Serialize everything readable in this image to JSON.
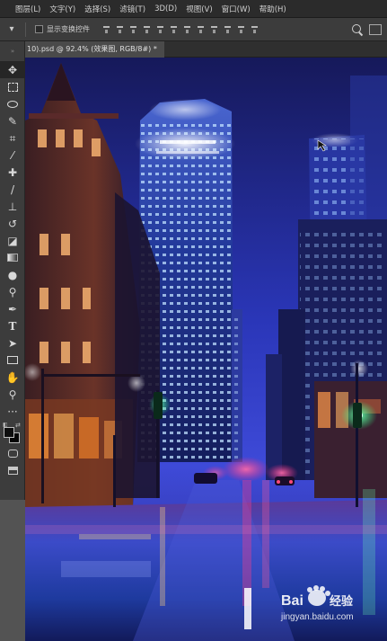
{
  "menubar": {
    "items": [
      "图层(L)",
      "文字(Y)",
      "选择(S)",
      "滤镜(T)",
      "3D(D)",
      "视图(V)",
      "窗口(W)",
      "帮助(H)"
    ]
  },
  "options": {
    "show_transform_controls": "显示变换控件",
    "checked": false
  },
  "document": {
    "tab_title": "10).psd @ 92.4% (效果图, RGB/8#) *"
  },
  "toolbar": {
    "tools": [
      "move-tool",
      "marquee-tool",
      "lasso-tool",
      "quick-select-tool",
      "crop-tool",
      "eyedropper-tool",
      "healing-brush-tool",
      "brush-tool",
      "clone-stamp-tool",
      "history-brush-tool",
      "eraser-tool",
      "gradient-tool",
      "blur-tool",
      "dodge-tool",
      "pen-tool",
      "type-tool",
      "path-select-tool",
      "rectangle-tool",
      "hand-tool",
      "zoom-tool",
      "more-tools"
    ],
    "foreground_color": "#0e0e0e",
    "background_color": "#050505"
  },
  "watermark": {
    "brand": "Bai",
    "brand_tail": "经验",
    "url": "jingyan.baidu.com"
  },
  "colors": {
    "menubar_bg": "#2b2b2b",
    "panel_bg": "#3c3c3c",
    "sky": "#1b1f6a",
    "street_light": "#ff3b8a",
    "traffic_green": "#35ff7a"
  }
}
